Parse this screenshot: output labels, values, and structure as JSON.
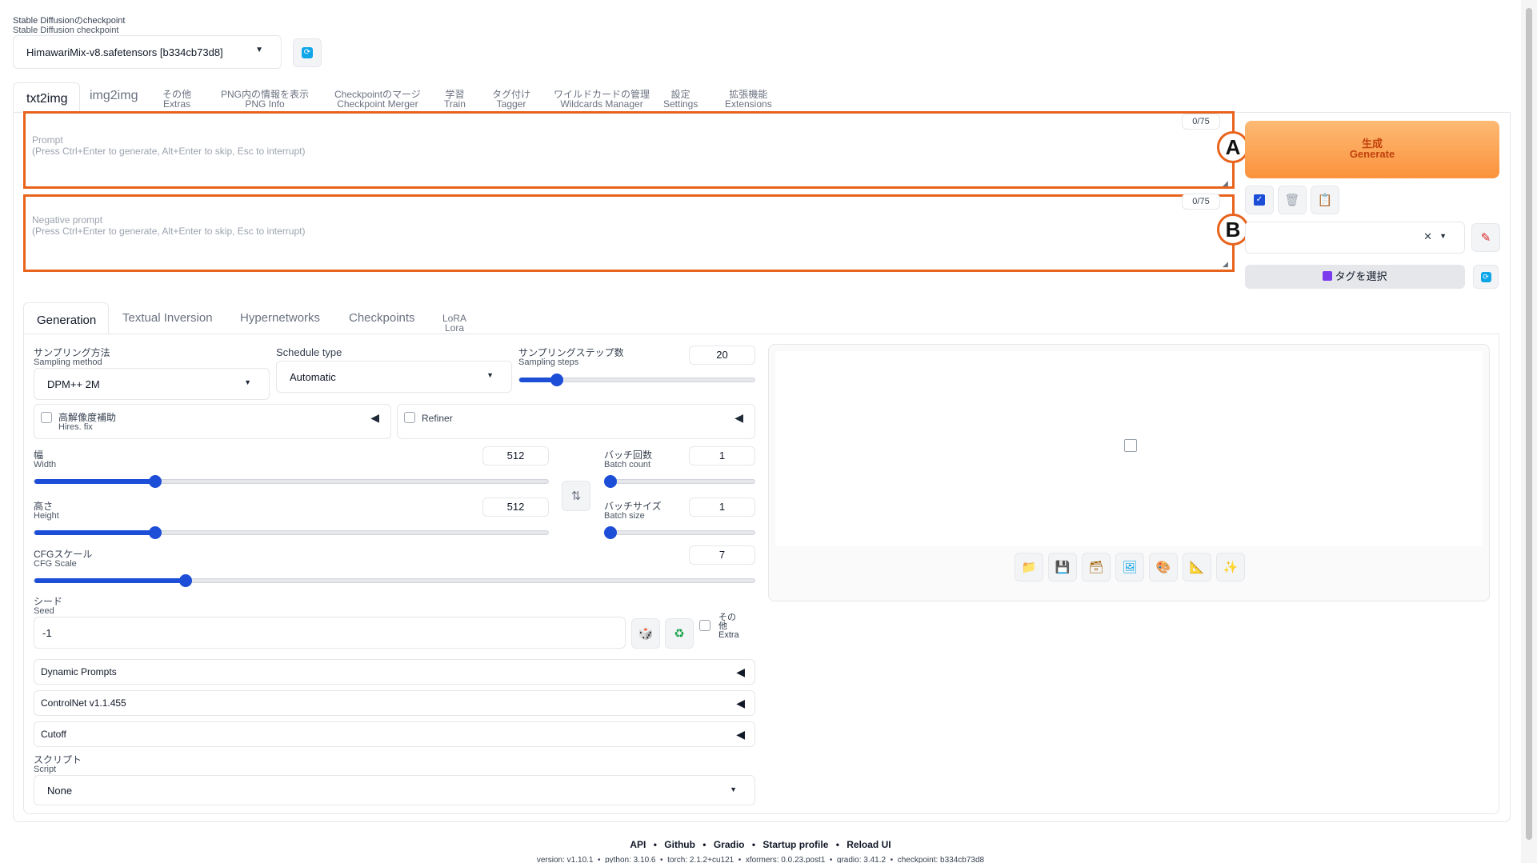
{
  "checkpoint": {
    "label_ja": "Stable Diffusionのcheckpoint",
    "label_en": "Stable Diffusion checkpoint",
    "value": "HimawariMix-v8.safetensors [b334cb73d8]"
  },
  "tabs": [
    {
      "ja": "txt2img",
      "en": ""
    },
    {
      "ja": "img2img",
      "en": ""
    },
    {
      "ja": "その他",
      "en": "Extras"
    },
    {
      "ja": "PNG内の情報を表示",
      "en": "PNG Info"
    },
    {
      "ja": "Checkpointのマージ",
      "en": "Checkpoint Merger"
    },
    {
      "ja": "学習",
      "en": "Train"
    },
    {
      "ja": "タグ付け",
      "en": "Tagger"
    },
    {
      "ja": "ワイルドカードの管理",
      "en": "Wildcards Manager"
    },
    {
      "ja": "設定",
      "en": "Settings"
    },
    {
      "ja": "拡張機能",
      "en": "Extensions"
    }
  ],
  "prompt": {
    "label": "Prompt",
    "placeholder": "(Press Ctrl+Enter to generate, Alt+Enter to skip, Esc to interrupt)",
    "counter": "0/75",
    "marker": "A"
  },
  "negative_prompt": {
    "label": "Negative prompt",
    "placeholder": "(Press Ctrl+Enter to generate, Alt+Enter to skip, Esc to interrupt)",
    "counter": "0/75",
    "marker": "B"
  },
  "generate": {
    "ja": "生成",
    "en": "Generate"
  },
  "tag_select": "タグを選択",
  "subtabs": [
    {
      "label": "Generation",
      "sub": ""
    },
    {
      "label": "Textual Inversion",
      "sub": ""
    },
    {
      "label": "Hypernetworks",
      "sub": ""
    },
    {
      "label": "Checkpoints",
      "sub": ""
    },
    {
      "label": "LoRA",
      "sub": "Lora"
    }
  ],
  "sampling_method": {
    "ja": "サンプリング方法",
    "en": "Sampling method",
    "value": "DPM++ 2M"
  },
  "schedule_type": {
    "label": "Schedule type",
    "value": "Automatic"
  },
  "sampling_steps": {
    "ja": "サンプリングステップ数",
    "en": "Sampling steps",
    "value": "20",
    "fraction": 0.16
  },
  "hires_fix": {
    "ja": "高解像度補助",
    "en": "Hires. fix"
  },
  "refiner": {
    "label": "Refiner"
  },
  "width": {
    "ja": "幅",
    "en": "Width",
    "value": "512",
    "fraction": 0.235
  },
  "height": {
    "ja": "高さ",
    "en": "Height",
    "value": "512",
    "fraction": 0.235
  },
  "batch_count": {
    "ja": "バッチ回数",
    "en": "Batch count",
    "value": "1",
    "fraction": 0.0
  },
  "batch_size": {
    "ja": "バッチサイズ",
    "en": "Batch size",
    "value": "1",
    "fraction": 0.0
  },
  "cfg_scale": {
    "ja": "CFGスケール",
    "en": "CFG Scale",
    "value": "7",
    "fraction": 0.21
  },
  "seed": {
    "ja": "シード",
    "en": "Seed",
    "value": "-1"
  },
  "extra": {
    "ja1": "その",
    "ja2": "他",
    "en": "Extra"
  },
  "accordions": [
    "Dynamic Prompts",
    "ControlNet v1.1.455",
    "Cutoff"
  ],
  "script": {
    "ja": "スクリプト",
    "en": "Script",
    "value": "None"
  },
  "footer": {
    "links": [
      "API",
      "Github",
      "Gradio",
      "Startup profile",
      "Reload UI"
    ],
    "version": "version: v1.10.1  •  python: 3.10.6  •  torch: 2.1.2+cu121  •  xformers: 0.0.23.post1  •  gradio: 3.41.2  •  checkpoint: b334cb73d8"
  }
}
